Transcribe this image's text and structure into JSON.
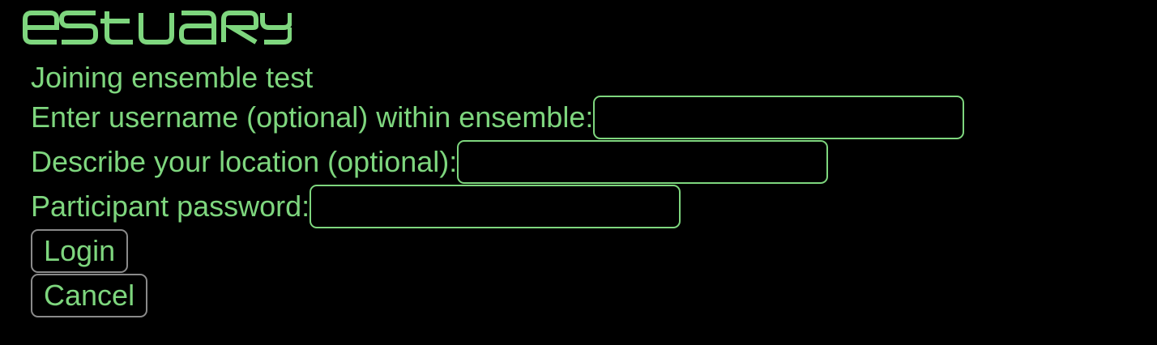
{
  "app": {
    "logo_text": "estuary",
    "accent_color": "#7ed67e"
  },
  "main": {
    "heading": "Joining ensemble test",
    "username_label": "Enter username (optional) within ensemble:",
    "username_value": "",
    "location_label": "Describe your location (optional):",
    "location_value": "",
    "password_label": "Participant password:",
    "password_value": "",
    "login_label": "Login",
    "cancel_label": "Cancel"
  }
}
